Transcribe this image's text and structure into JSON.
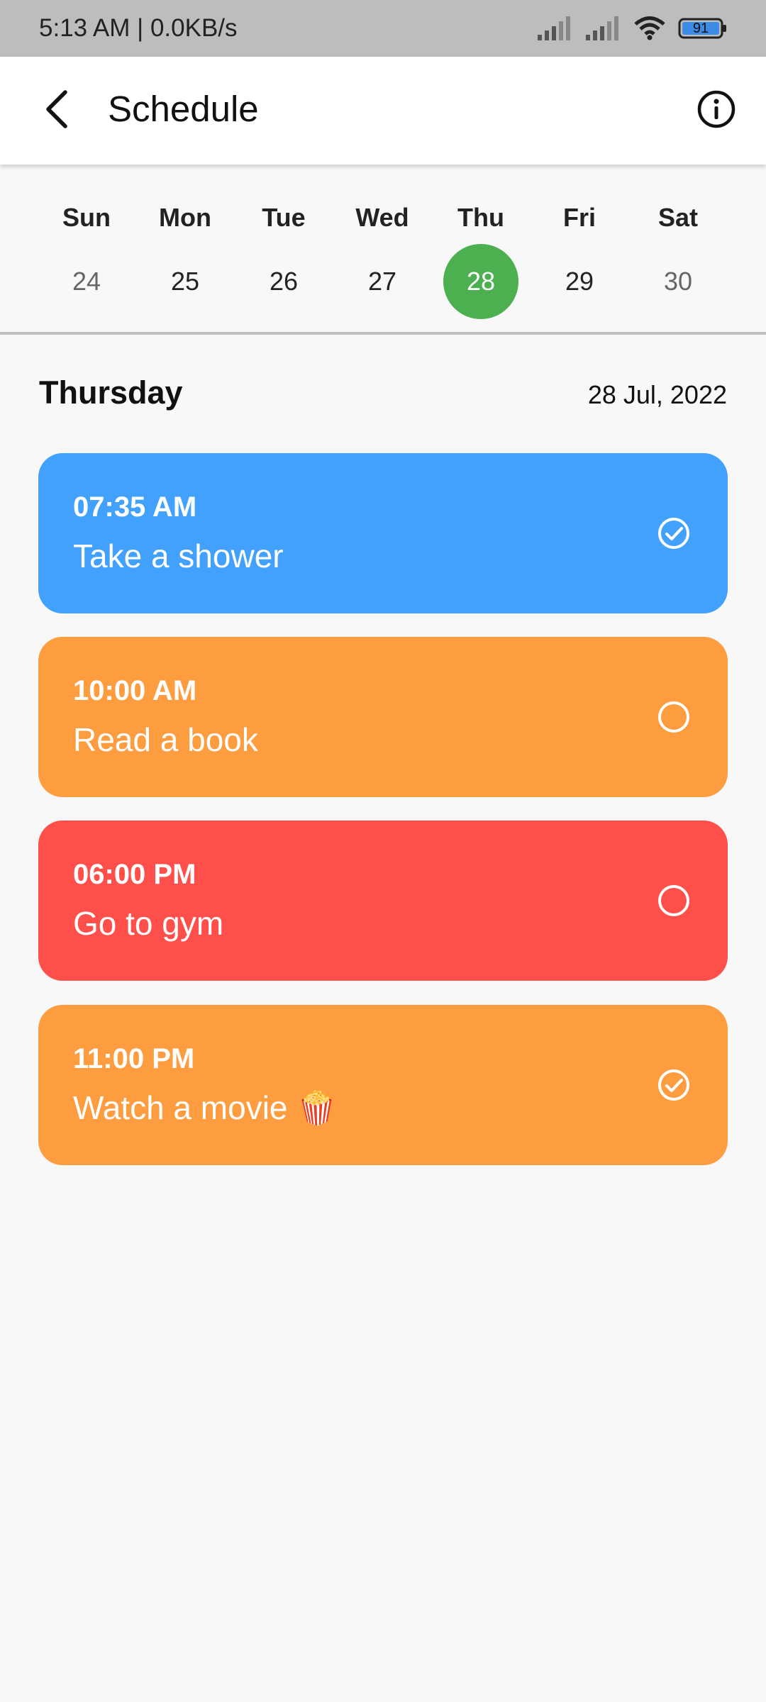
{
  "status_bar": {
    "time_speed": "5:13 AM | 0.0KB/s",
    "battery": "91",
    "icons": [
      "signal-icon",
      "signal-icon",
      "wifi-icon",
      "battery-icon"
    ]
  },
  "app_bar": {
    "title": "Schedule",
    "back_icon": "back-arrow-icon",
    "info_icon": "info-icon"
  },
  "week": {
    "days": [
      {
        "name": "Sun",
        "date": "24",
        "selected": false
      },
      {
        "name": "Mon",
        "date": "25",
        "selected": false
      },
      {
        "name": "Tue",
        "date": "26",
        "selected": false
      },
      {
        "name": "Wed",
        "date": "27",
        "selected": false
      },
      {
        "name": "Thu",
        "date": "28",
        "selected": true
      },
      {
        "name": "Fri",
        "date": "29",
        "selected": false
      },
      {
        "name": "Sat",
        "date": "30",
        "selected": false
      }
    ],
    "selected_color": "#4caf50"
  },
  "day": {
    "title": "Thursday",
    "date": "28 Jul, 2022"
  },
  "tasks": [
    {
      "time": "07:35 AM",
      "title": "Take a shower",
      "done": true,
      "color": "#42a1fc"
    },
    {
      "time": "10:00 AM",
      "title": "Read a book",
      "done": false,
      "color": "#fe9d40"
    },
    {
      "time": "06:00 PM",
      "title": "Go to gym",
      "done": false,
      "color": "#ff4f4a"
    },
    {
      "time": "11:00 PM",
      "title": "Watch a movie 🍿",
      "done": true,
      "color": "#fe9d40"
    }
  ]
}
